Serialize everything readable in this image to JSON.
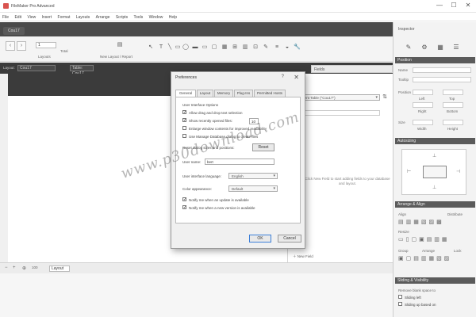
{
  "app": {
    "title": "FileMaker Pro Advanced",
    "window_controls": [
      "—",
      "☐",
      "✕"
    ]
  },
  "menu": [
    "File",
    "Edit",
    "View",
    "Insert",
    "Format",
    "Layouts",
    "Arrange",
    "Scripts",
    "Tools",
    "Window",
    "Help"
  ],
  "document": {
    "tab": "Cou17"
  },
  "toolbar": {
    "record_value": "1",
    "total_label": "Total",
    "layouts_label": "Layouts",
    "new_layout_label": "New Layout / Report",
    "nav_back": "‹",
    "nav_forward": "›"
  },
  "layout_bar": {
    "layout_label": "Layout:",
    "layout_value": "Cou17",
    "table_label": "Table: Cou17",
    "view_label": "Tables (Shift+Click)"
  },
  "field_panel": {
    "header": "Fields",
    "table_select": "Current Table (\"Cou17\")",
    "empty_text": "Click New Field to start adding fields to your database and layout.",
    "new_field": "New Field",
    "drag_options": "Drag Options"
  },
  "inspector": {
    "title": "Inspector",
    "tabs": [
      "✎",
      "⚙",
      "▦",
      "☰"
    ],
    "section_position": "Position",
    "name_label": "Name",
    "tooltip_label": "Tooltip",
    "position_label": "Position",
    "left_label": "Left",
    "top_label": "Top",
    "right_label": "Right",
    "bottom_label": "Bottom",
    "size_label": "Size",
    "width_label": "Width",
    "height_label": "Height",
    "section_autosizing": "Autosizing",
    "section_grid": "Arrange & Align",
    "align_label": "Align",
    "distribute_label": "Distribute",
    "resize_label": "Resize",
    "group_label": "Group",
    "arrange_label": "Arrange",
    "lock_label": "Lock",
    "section_sliding": "Sliding & Visibility",
    "remove_label": "Remove blank space to",
    "sliding_left": "Sliding left",
    "sliding_up": "Sliding up based on"
  },
  "dialog": {
    "title": "Preferences",
    "help": "?",
    "close": "✕",
    "tabs": [
      "General",
      "Layout",
      "Memory",
      "Plug-Ins",
      "Permitted Hosts"
    ],
    "section_title": "User Interface Options",
    "options": [
      {
        "label": "Allow drag and drop text selection",
        "checked": true
      },
      {
        "label": "Show recently opened files:",
        "checked": true
      },
      {
        "label": "Enlarge window contents for improved readability",
        "checked": false
      },
      {
        "label": "Use Manage Database dialog to create files",
        "checked": false
      }
    ],
    "recent_files_count": "10",
    "reset_label": "Reset dialog sizes and positions:",
    "reset_button": "Reset",
    "user_name_label": "User name:",
    "user_name_value": "bert",
    "user_interface_label": "User interface language:",
    "language_value": "English",
    "color_label": "Color appearance:",
    "color_value": "Default",
    "notify_update": "Notify me when an update is available",
    "notify_new": "Notify me when a new version is available",
    "ok": "OK",
    "cancel": "Cancel"
  },
  "status": {
    "zoom": "100",
    "mode": "Layout"
  },
  "watermark": "www.p30download.com",
  "colors": {
    "dark_bar": "#3b3b3b",
    "dialog_bg": "#f0f0f0",
    "accent": "#3c7fd8"
  }
}
